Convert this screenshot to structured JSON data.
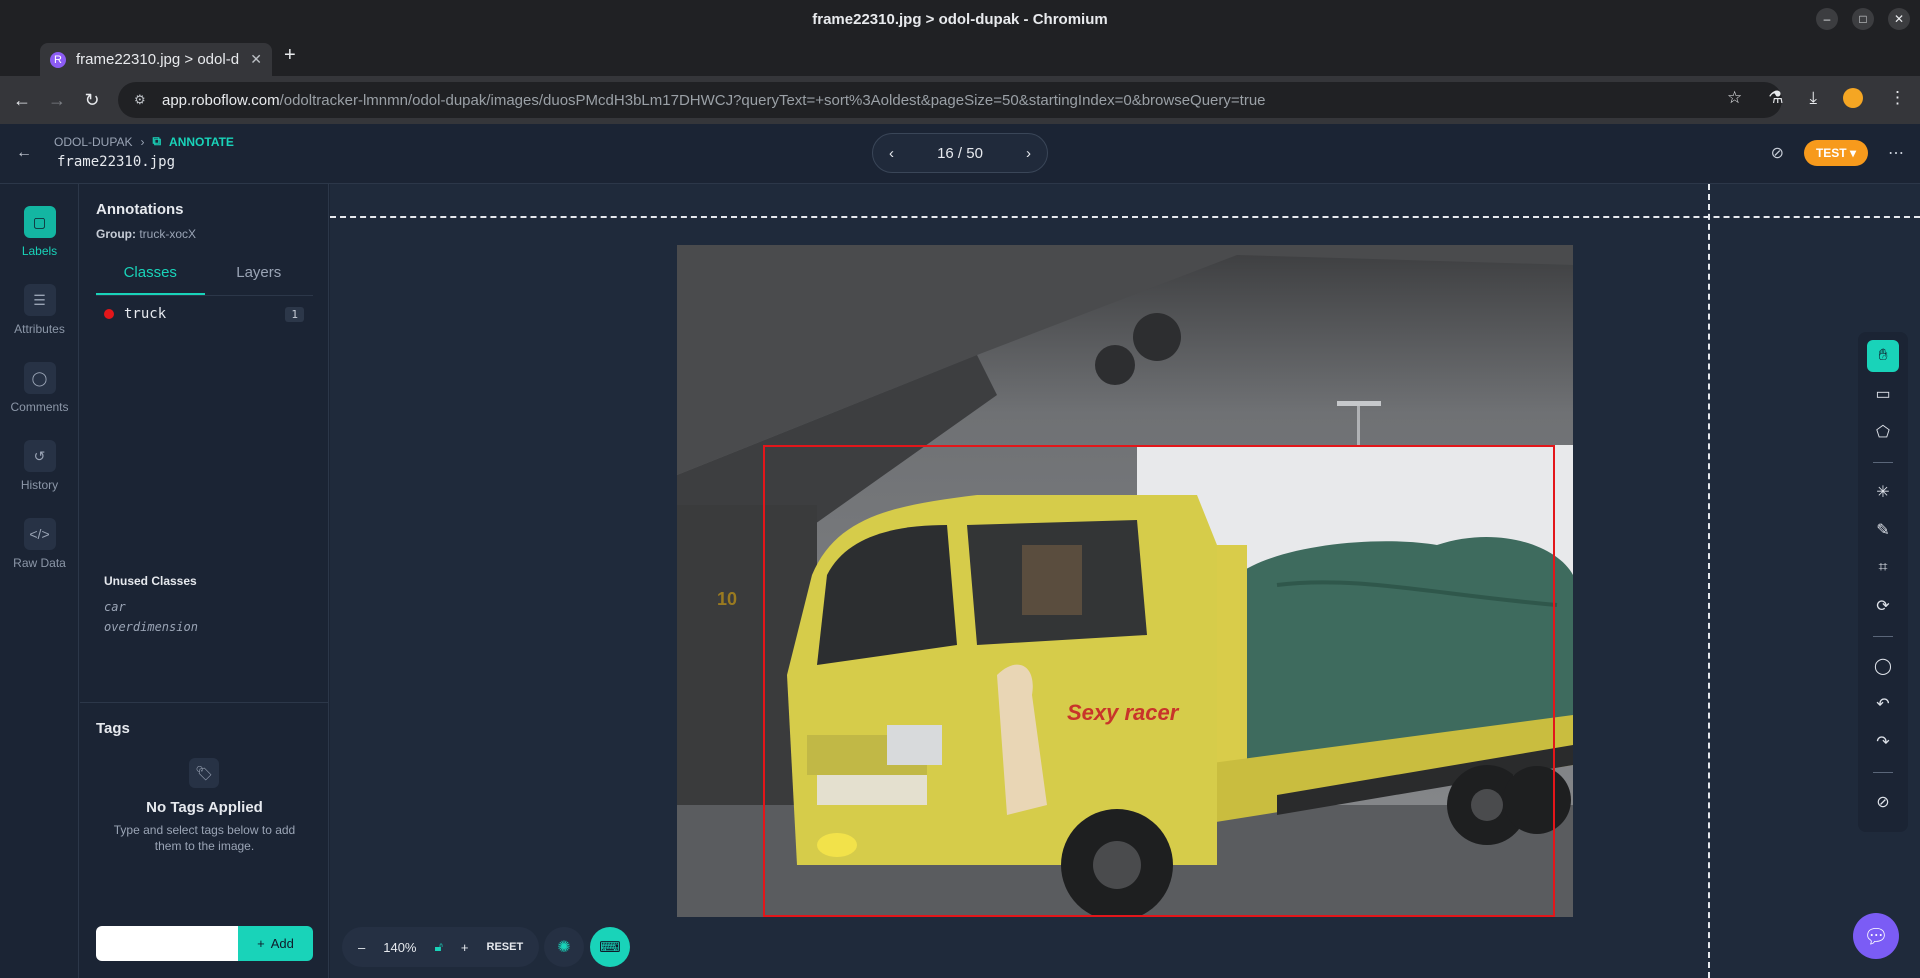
{
  "browser": {
    "window_title": "frame22310.jpg > odol-dupak - Chromium",
    "tab_title": "frame22310.jpg > odol-d",
    "url_host": "app.roboflow.com",
    "url_path": "/odoltracker-lmnmn/odol-dupak/images/duosPMcdH3bLm17DHWCJ?queryText=+sort%3Aoldest&pageSize=50&startingIndex=0&browseQuery=true"
  },
  "header": {
    "project": "ODOL-DUPAK",
    "mode": "ANNOTATE",
    "filename": "frame22310.jpg",
    "pager": "16 / 50",
    "test_label": "TEST"
  },
  "rail": {
    "items": [
      {
        "label": "Labels",
        "icon": "label-icon"
      },
      {
        "label": "Attributes",
        "icon": "list-icon"
      },
      {
        "label": "Comments",
        "icon": "comment-icon"
      },
      {
        "label": "History",
        "icon": "history-icon"
      },
      {
        "label": "Raw Data",
        "icon": "code-icon"
      }
    ]
  },
  "annotations": {
    "title": "Annotations",
    "group_label": "Group:",
    "group_value": "truck-xocX",
    "tabs": [
      "Classes",
      "Layers"
    ],
    "classes": [
      {
        "name": "truck",
        "count": "1",
        "color": "#e3161a"
      }
    ],
    "unused_title": "Unused Classes",
    "unused": [
      "car",
      "overdimension"
    ]
  },
  "tags": {
    "title": "Tags",
    "empty_title": "No Tags Applied",
    "empty_sub": "Type and select tags below to add them to the image.",
    "add_label": "Add"
  },
  "canvas": {
    "zoom": "140%",
    "reset_label": "RESET"
  }
}
